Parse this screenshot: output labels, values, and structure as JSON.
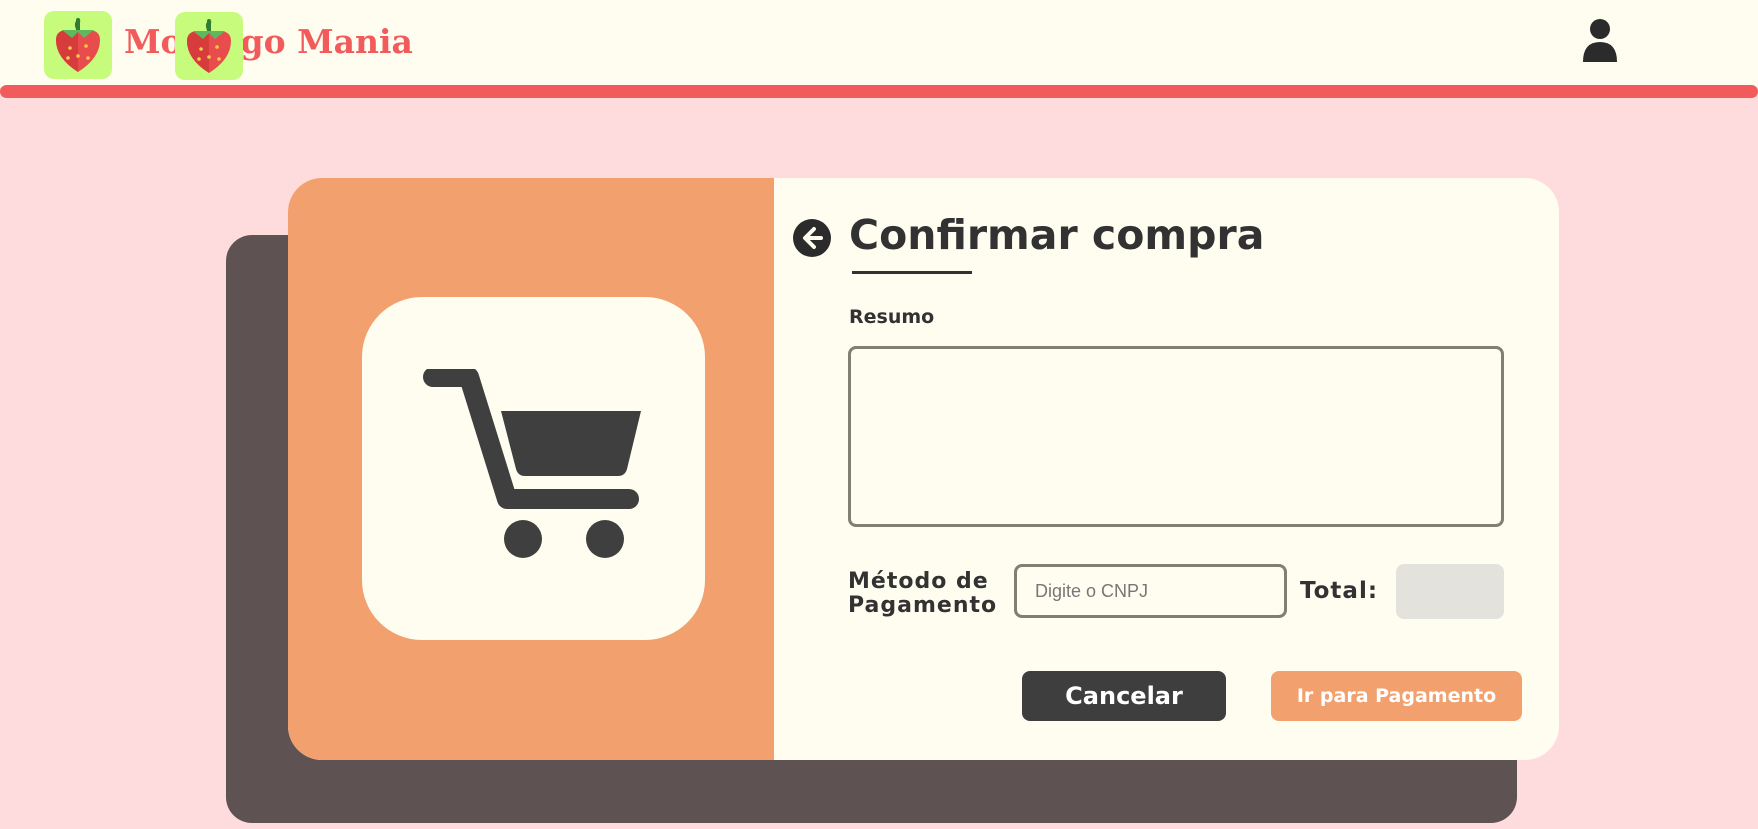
{
  "header": {
    "brand": "Morango Mania",
    "brand_visible_left": "Mo",
    "brand_visible_right": "go Mania",
    "accent_color": "#f25b5b",
    "logo_icon": "strawberry-icon",
    "user_icon": "user-icon"
  },
  "purchase": {
    "title": "Confirmar compra",
    "back_icon": "arrow-left-circle-icon",
    "summary_label": "Resumo",
    "summary_value": "",
    "payment_method_label": "Método de Pagamento",
    "cnpj_placeholder": "Digite o CNPJ",
    "cnpj_value": "",
    "total_label": "Total:",
    "total_value": "",
    "cancel_label": "Cancelar",
    "pay_label": "Ir para Pagamento",
    "cart_icon": "shopping-cart-icon"
  },
  "colors": {
    "background": "#fedbdc",
    "panel_orange": "#f2a06e",
    "card_cream": "#fefdf0",
    "dark": "#3e3e3e"
  }
}
